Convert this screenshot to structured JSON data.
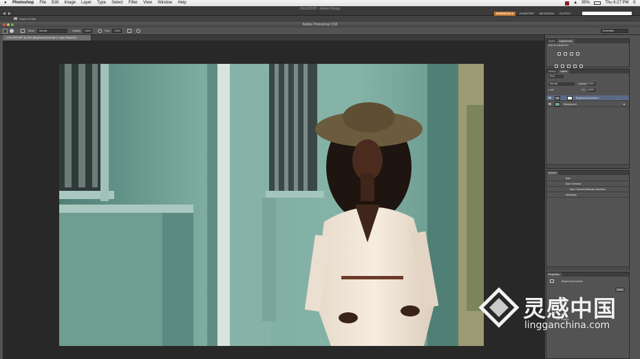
{
  "menubar": {
    "app_name": "Photoshop",
    "items": [
      "File",
      "Edit",
      "Image",
      "Layer",
      "Type",
      "Select",
      "Filter",
      "View",
      "Window",
      "Help"
    ],
    "status_left": "95%",
    "clock": "Thu 6:27 PM"
  },
  "appbar": {
    "title": "ZAUG8005 - Adobe Bridge",
    "workspaces": [
      "ESSENTIALS",
      "FILMSTRIP",
      "METADATA",
      "OUTPUT"
    ],
    "bridge_path": "Shots & Edits"
  },
  "ps_window": {
    "title": "Adobe Photoshop CS6"
  },
  "options_bar": {
    "mode_label": "Mode:",
    "mode_value": "Normal",
    "opacity_label": "Opacity:",
    "opacity_value": "100%",
    "flow_label": "Flow:",
    "flow_value": "100%",
    "workspace_value": "Essentials"
  },
  "document": {
    "tab_label": "_DSC2025.NEF @ 25% (Brightness/Contrast 1, Layer Mask/16) *"
  },
  "panels": {
    "top": {
      "tabs": [
        "Styles",
        "Adjustments"
      ],
      "active_index": 1,
      "caption": "Add an adjustment"
    },
    "layers": {
      "tabs": [
        "History",
        "Layers"
      ],
      "active_index": 1,
      "kind_label": "Kind",
      "blend_mode": "Normal",
      "opacity_label": "Opacity:",
      "opacity_value": "100%",
      "lock_label": "Lock:",
      "fill_label": "Fill:",
      "fill_value": "100%",
      "layers": [
        "Brightness/Contrast 1",
        "Background"
      ]
    },
    "actions": {
      "tabs": [
        "Actions"
      ],
      "items": [
        "Sets",
        "Sam Chevrest",
        "Sam Chevrest Skincare Workflow",
        "Workshop"
      ]
    },
    "properties": {
      "tabs": [
        "Properties"
      ],
      "title": "Brightness/Contrast",
      "auto_label": "Auto",
      "use_legacy": "Use Legacy"
    }
  },
  "watermark": {
    "brand": "灵感中国",
    "url": "lingganchina.com"
  }
}
